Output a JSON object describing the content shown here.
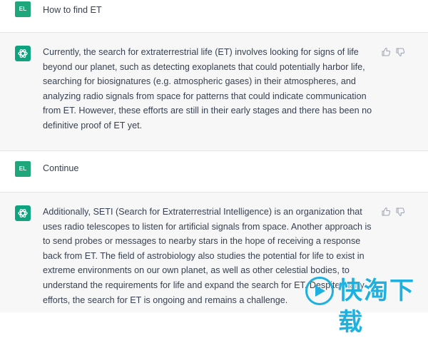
{
  "conversation": [
    {
      "role": "user",
      "avatar": "EL",
      "text": "How to find ET"
    },
    {
      "role": "assistant",
      "text": "Currently, the search for extraterrestrial life (ET) involves looking for signs of life beyond our planet, such as detecting exoplanets that could potentially harbor life, searching for biosignatures (e.g. atmospheric gases) in their atmospheres, and analyzing radio signals from space for patterns that could indicate communication from ET. However, these efforts are still in their early stages and there has been no definitive proof of ET yet."
    },
    {
      "role": "user",
      "avatar": "EL",
      "text": "Continue"
    },
    {
      "role": "assistant",
      "text": "Additionally, SETI (Search for Extraterrestrial Intelligence) is an organization that uses radio telescopes to listen for artificial signals from space. Another approach is to send probes or messages to nearby stars in the hope of receiving a response back from ET. The field of astrobiology also studies the potential for life to exist in extreme environments on our own planet, as well as other celestial bodies, to understand the requirements for life and expand the search for ET. Despite many efforts, the search for ET is ongoing and remains a challenge."
    }
  ],
  "icons": {
    "like": "thumbs-up-icon",
    "dislike": "thumbs-down-icon",
    "assistant": "openai-logo-icon"
  },
  "colors": {
    "user_avatar": "#1fa67a",
    "assistant_avatar": "#10a37f",
    "assistant_bg": "#f7f7f8"
  },
  "watermark": {
    "text": "快淘下载"
  }
}
